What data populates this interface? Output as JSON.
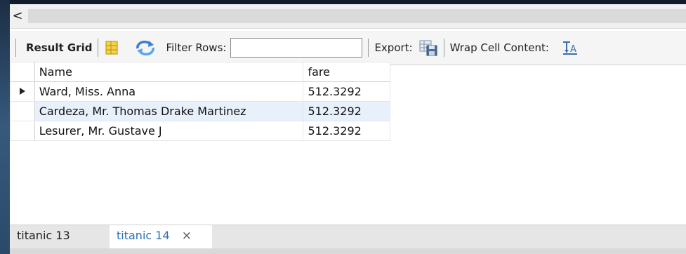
{
  "topbar": {
    "back_label": "<"
  },
  "toolbar": {
    "result_grid_label": "Result Grid",
    "filter_rows_label": "Filter Rows:",
    "filter_value": "",
    "export_label": "Export:",
    "wrap_label": "Wrap Cell Content:",
    "icons": [
      "grid-toggle-icon",
      "refresh-icon",
      "export-icon",
      "wrap-cell-icon"
    ]
  },
  "grid": {
    "columns": [
      "Name",
      "fare"
    ],
    "rows": [
      {
        "name": "Ward, Miss. Anna",
        "fare": "512.3292",
        "current": true
      },
      {
        "name": "Cardeza, Mr. Thomas Drake Martinez",
        "fare": "512.3292",
        "current": false
      },
      {
        "name": "Lesurer, Mr. Gustave J",
        "fare": "512.3292",
        "current": false
      }
    ]
  },
  "tabs": [
    {
      "label": "titanic 13",
      "active": false
    },
    {
      "label": "titanic 14",
      "active": true,
      "close_glyph": "×"
    }
  ],
  "colors": {
    "active_tab_text": "#2a6fb6",
    "selected_row": "#e8f0fb"
  }
}
